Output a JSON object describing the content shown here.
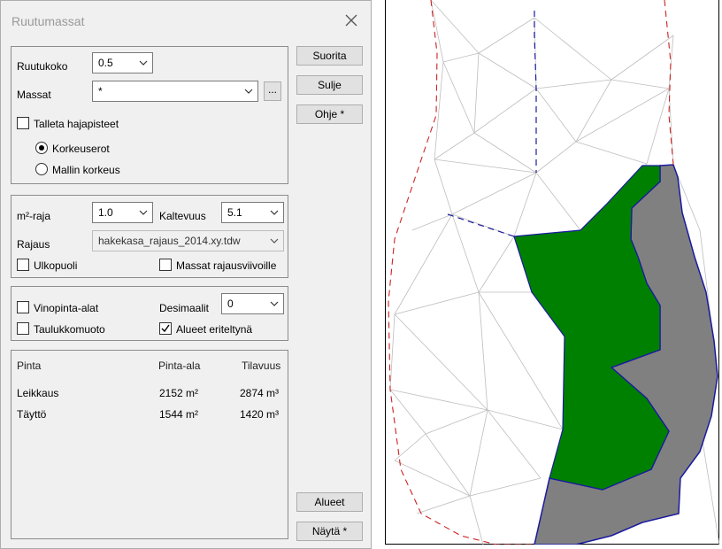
{
  "dialog": {
    "title": "Ruutumassat",
    "group1": {
      "ruutukoko_label": "Ruutukoko",
      "ruutukoko_value": "0.5",
      "massat_label": "Massat",
      "massat_value": "*",
      "browse_label": "...",
      "talleta_label": "Talleta hajapisteet",
      "talleta_checked": false,
      "radio_korkeuserot": "Korkeuserot",
      "radio_mallin": "Mallin korkeus",
      "selected_radio": "Korkeuserot"
    },
    "group2": {
      "m2raja_label": "m²-raja",
      "m2raja_value": "1.0",
      "kaltevuus_label": "Kaltevuus",
      "kaltevuus_value": "5.1",
      "rajaus_label": "Rajaus",
      "rajaus_value": "hakekasa_rajaus_2014.xy.tdw",
      "ulkopuoli_label": "Ulkopuoli",
      "ulkopuoli_checked": false,
      "massat_rajaus_label": "Massat rajausviivoille",
      "massat_rajaus_checked": false
    },
    "group3": {
      "vinopinta_label": "Vinopinta-alat",
      "vinopinta_checked": false,
      "taulukko_label": "Taulukkomuoto",
      "taulukko_checked": false,
      "desimaalit_label": "Desimaalit",
      "desimaalit_value": "0",
      "alueet_eriteltyna_label": "Alueet eriteltynä",
      "alueet_eriteltyna_checked": true
    },
    "results": {
      "headers": [
        "Pinta",
        "Pinta-ala",
        "Tilavuus"
      ],
      "rows": [
        [
          "Leikkaus",
          "2152 m²",
          "2874 m³"
        ],
        [
          "Täyttö",
          "1544 m²",
          "1420 m³"
        ]
      ]
    },
    "buttons": {
      "suorita": "Suorita",
      "sulje": "Sulje",
      "ohje": "Ohje *",
      "alueet": "Alueet",
      "nayta": "Näytä *"
    }
  },
  "map": {
    "colors": {
      "cut_area": "#008000",
      "fill_area": "#808080",
      "boundary_red": "#cc2222",
      "boundary_blue": "#1a1aa0",
      "tin": "#bdbdbd"
    }
  }
}
